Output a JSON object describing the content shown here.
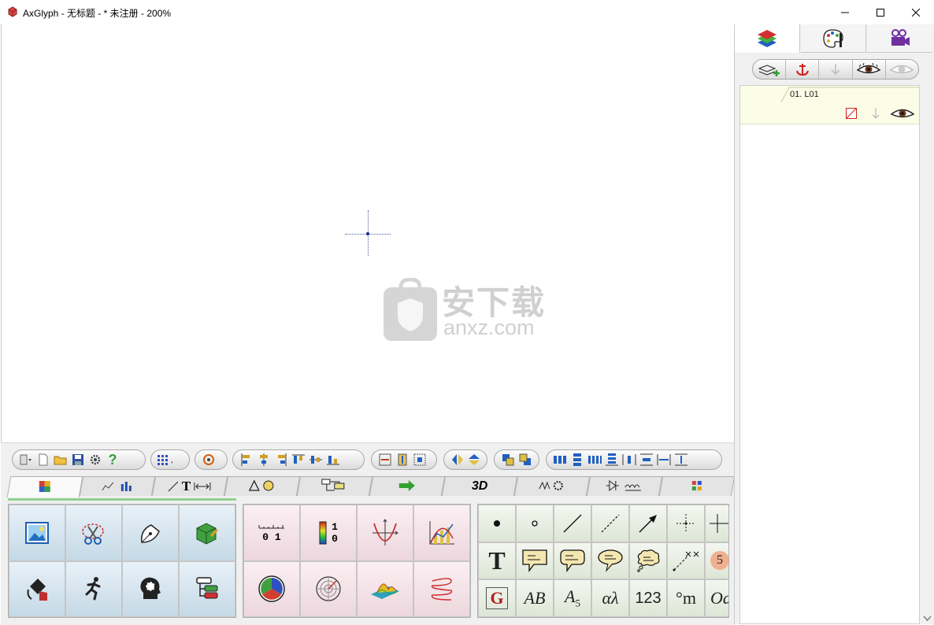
{
  "window": {
    "title": "AxGlyph - 无标题 - * 未注册 - 200%",
    "minimize_glyph": "—",
    "maximize_glyph": "☐",
    "close_glyph": "✕"
  },
  "watermark": {
    "text": "安下载",
    "subtext": "anxz.com"
  },
  "toolbar_groups": [
    {
      "name": "file",
      "icons": [
        "menu-dropdown-icon",
        "new-file-icon",
        "open-folder-icon",
        "save-icon",
        "settings-icon",
        "help-icon"
      ]
    },
    {
      "name": "grid",
      "icons": [
        "grid-icon"
      ]
    },
    {
      "name": "rotate",
      "icons": [
        "rotate-icon"
      ]
    },
    {
      "name": "align",
      "icons": [
        "align-left-icon",
        "align-center-h-icon",
        "align-right-icon",
        "align-top-icon",
        "align-middle-icon",
        "align-bottom-icon"
      ]
    },
    {
      "name": "size",
      "icons": [
        "same-width-icon",
        "same-height-icon",
        "same-size-icon"
      ]
    },
    {
      "name": "flip",
      "icons": [
        "flip-horizontal-icon",
        "flip-vertical-icon"
      ]
    },
    {
      "name": "order",
      "icons": [
        "bring-front-icon",
        "send-back-icon"
      ]
    },
    {
      "name": "distribute",
      "icons": [
        "distribute-h-icon",
        "distribute-v-icon",
        "space-h-icon",
        "space-v-icon",
        "gap-h-icon",
        "gap-v-icon",
        "equal-h-icon",
        "equal-v-icon"
      ]
    }
  ],
  "tabs": [
    {
      "name": "gallery",
      "label": ""
    },
    {
      "name": "chart",
      "label": ""
    },
    {
      "name": "line-text",
      "label": "T"
    },
    {
      "name": "shapes",
      "label": ""
    },
    {
      "name": "flow",
      "label": ""
    },
    {
      "name": "arrows",
      "label": ""
    },
    {
      "name": "3d",
      "label": "3D"
    },
    {
      "name": "physics",
      "label": ""
    },
    {
      "name": "circuit",
      "label": ""
    },
    {
      "name": "more",
      "label": ""
    }
  ],
  "panel1": [
    "picture-icon",
    "scissors-icon",
    "pen-nib-icon",
    "3d-box-icon",
    "pour-icon",
    "running-man-icon",
    "head-gear-icon",
    "tree-icon"
  ],
  "panel2": {
    "ruler_label": "0 1",
    "colorbar_top": "1",
    "colorbar_bottom": "0"
  },
  "panel3": {
    "row2": [
      "T"
    ],
    "row3": [
      "G",
      "AB",
      "A",
      "5",
      "αλ",
      "123",
      "°m",
      "Oa"
    ],
    "badge": "5"
  },
  "right_tabs": [
    "layers-icon",
    "palette-icon",
    "video-camera-icon"
  ],
  "layer_tools": [
    "add-layer-icon",
    "anchor-icon",
    "anchor-disabled-icon",
    "eye-icon",
    "eye-disabled-icon"
  ],
  "layers": [
    {
      "name": "01. L01"
    }
  ],
  "colors": {
    "accent_green": "#8fd18f",
    "layer_bg": "#fbfde6"
  }
}
